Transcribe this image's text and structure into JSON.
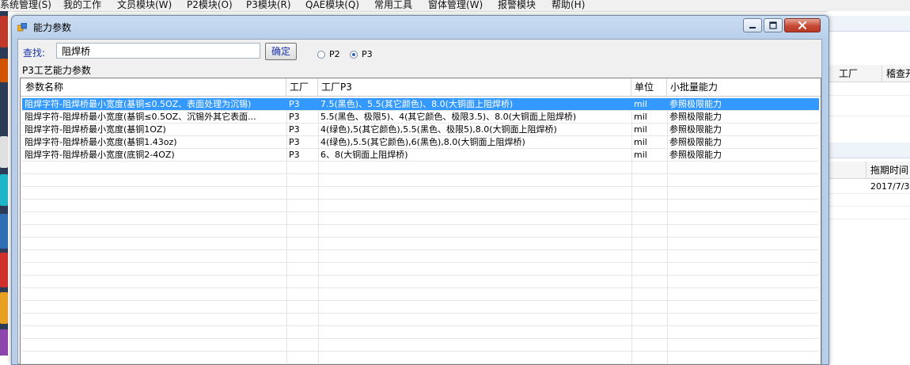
{
  "menubar": {
    "items": [
      "系统管理(S)",
      "我的工作",
      "文员模块(W)",
      "P2模块(O)",
      "P3模块(R)",
      "QAE模块(Q)",
      "常用工具",
      "窗体管理(W)",
      "报警模块",
      "帮助(H)"
    ]
  },
  "background": {
    "col_factory": "工厂",
    "col_audit": "稽查开",
    "col_deadline": "拖期时间",
    "deadline_value": "2017/7/3"
  },
  "dialog": {
    "title": "能力参数",
    "find_label": "查找:",
    "find_value": "阻焊桥",
    "confirm_label": "确定",
    "radio_p2": "P2",
    "radio_p3": "P3",
    "selected_radio": "P3",
    "section_label": "P3工艺能力参数"
  },
  "table": {
    "columns": [
      "参数名称",
      "工厂",
      "工厂P3",
      "单位",
      "小批量能力"
    ],
    "rows": [
      [
        "阻焊字符-阻焊桥最小宽度(基铜≤0.5OZ、表面处理为沉锡)",
        "P3",
        "7.5(黑色)、5.5(其它颜色)、8.0(大铜面上阻焊桥)",
        "mil",
        "参照极限能力"
      ],
      [
        "阻焊字符-阻焊桥最小宽度(基铜≤0.5OZ、沉锡外其它表面...",
        "P3",
        "5.5(黑色、极限5)、4(其它颜色、极限3.5)、8.0(大铜面上阻焊桥)",
        "mil",
        "参照极限能力"
      ],
      [
        "阻焊字符-阻焊桥最小宽度(基铜1OZ)",
        "P3",
        "4(绿色),5(其它颜色),5.5(黑色、极限5),8.0(大铜面上阻焊桥)",
        "mil",
        "参照极限能力"
      ],
      [
        "阻焊字符-阻焊桥最小宽度(基铜1.43oz)",
        "P3",
        "4(绿色),5.5(其它颜色),6(黑色),8.0(大铜面上阻焊桥)",
        "mil",
        "参照极限能力"
      ],
      [
        "阻焊字符-阻焊桥最小宽度(底铜2-4OZ)",
        "P3",
        "6、8(大铜面上阻焊桥)",
        "mil",
        "参照极限能力"
      ]
    ],
    "selected_row": 0
  },
  "colors": {
    "selection": "#3399ff",
    "label_blue": "#1a33a6",
    "titlebar": "#b9cfe9"
  },
  "icons": {
    "app": "app-window-icon",
    "minimize": "minimize-icon",
    "maximize": "maximize-icon",
    "close": "close-icon"
  }
}
